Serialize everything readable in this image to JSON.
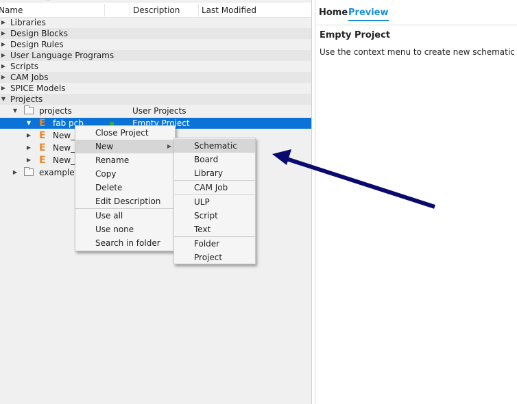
{
  "tree": {
    "columns": [
      "Name",
      "Description",
      "Last Modified"
    ],
    "rows": [
      {
        "label": "Libraries",
        "description": ""
      },
      {
        "label": "Design Blocks",
        "description": ""
      },
      {
        "label": "Design Rules",
        "description": ""
      },
      {
        "label": "User Language Programs",
        "description": ""
      },
      {
        "label": "Scripts",
        "description": ""
      },
      {
        "label": "CAM Jobs",
        "description": ""
      },
      {
        "label": "SPICE Models",
        "description": ""
      },
      {
        "label": "Projects",
        "description": ""
      },
      {
        "label": "projects",
        "description": "User Projects"
      },
      {
        "label": "fab pcb",
        "description": "Empty Project"
      },
      {
        "label": "New_",
        "description": ""
      },
      {
        "label": "New_",
        "description": ""
      },
      {
        "label": "New_",
        "description": ""
      },
      {
        "label": "examples",
        "description": ""
      }
    ]
  },
  "preview": {
    "tabs": [
      "Home",
      "Preview"
    ],
    "active_tab": "Preview",
    "title": "Empty Project",
    "text": "Use the context menu to create new schematic or b"
  },
  "context_menu": {
    "items": [
      "Close Project",
      "New",
      "Rename",
      "Copy",
      "Delete",
      "Edit Description",
      "Use all",
      "Use none",
      "Search in folder"
    ],
    "highlighted": "New"
  },
  "submenu_new": {
    "items": [
      "Schematic",
      "Board",
      "Library",
      "CAM Job",
      "ULP",
      "Script",
      "Text",
      "Folder",
      "Project"
    ],
    "highlighted": "Schematic"
  },
  "icons": {
    "expand": "triangle-right-icon",
    "collapse": "triangle-down-icon",
    "folder": "folder-icon",
    "project": "project-e-icon",
    "annotation": "pointer-arrow"
  },
  "colors": {
    "selection": "#0b73d8",
    "accent_tab": "#1a8dd6",
    "project_icon": "#e8892b",
    "annotation_arrow": "#0a0a6e"
  }
}
